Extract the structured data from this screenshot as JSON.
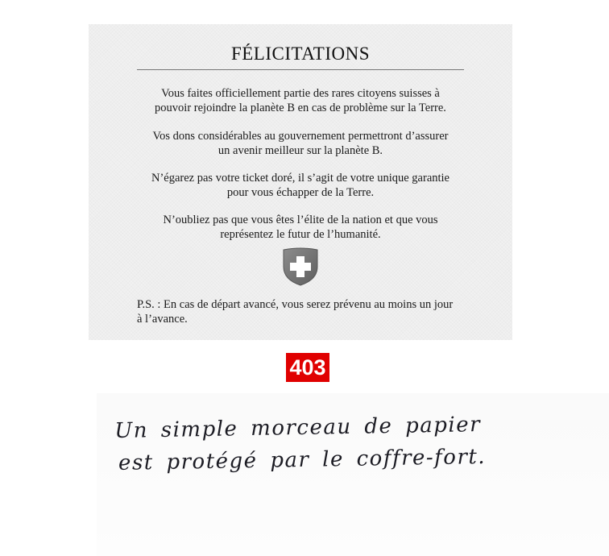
{
  "letter": {
    "title": "FÉLICITATIONS",
    "paragraphs": [
      {
        "line1": "Vous faites officiellement partie des rares citoyens suisses à",
        "line2": "pouvoir rejoindre la planète B en cas de problème sur la Terre."
      },
      {
        "line1": "Vos dons considérables au gouvernement permettront d’assurer",
        "line2": "un avenir meilleur sur la planète B."
      },
      {
        "line1": "N’égarez pas votre ticket doré, il s’agit de votre unique garantie",
        "line2": "pour vous échapper de la Terre."
      },
      {
        "line1": "N’oubliez pas que vous êtes l’élite de la nation et que vous",
        "line2": "représentez le futur de l’humanité."
      }
    ],
    "emblem_icon": "swiss-coat-of-arms-icon",
    "postscript": {
      "line1": "P.S. : En cas de départ avancé, vous serez prévenu au moins un jour",
      "line2": "à l’avance."
    }
  },
  "badge": {
    "label": "403",
    "color": "#e00000"
  },
  "note": {
    "line1": "Un simple morceau de papier",
    "line2": "est protégé par le coffre-fort."
  }
}
